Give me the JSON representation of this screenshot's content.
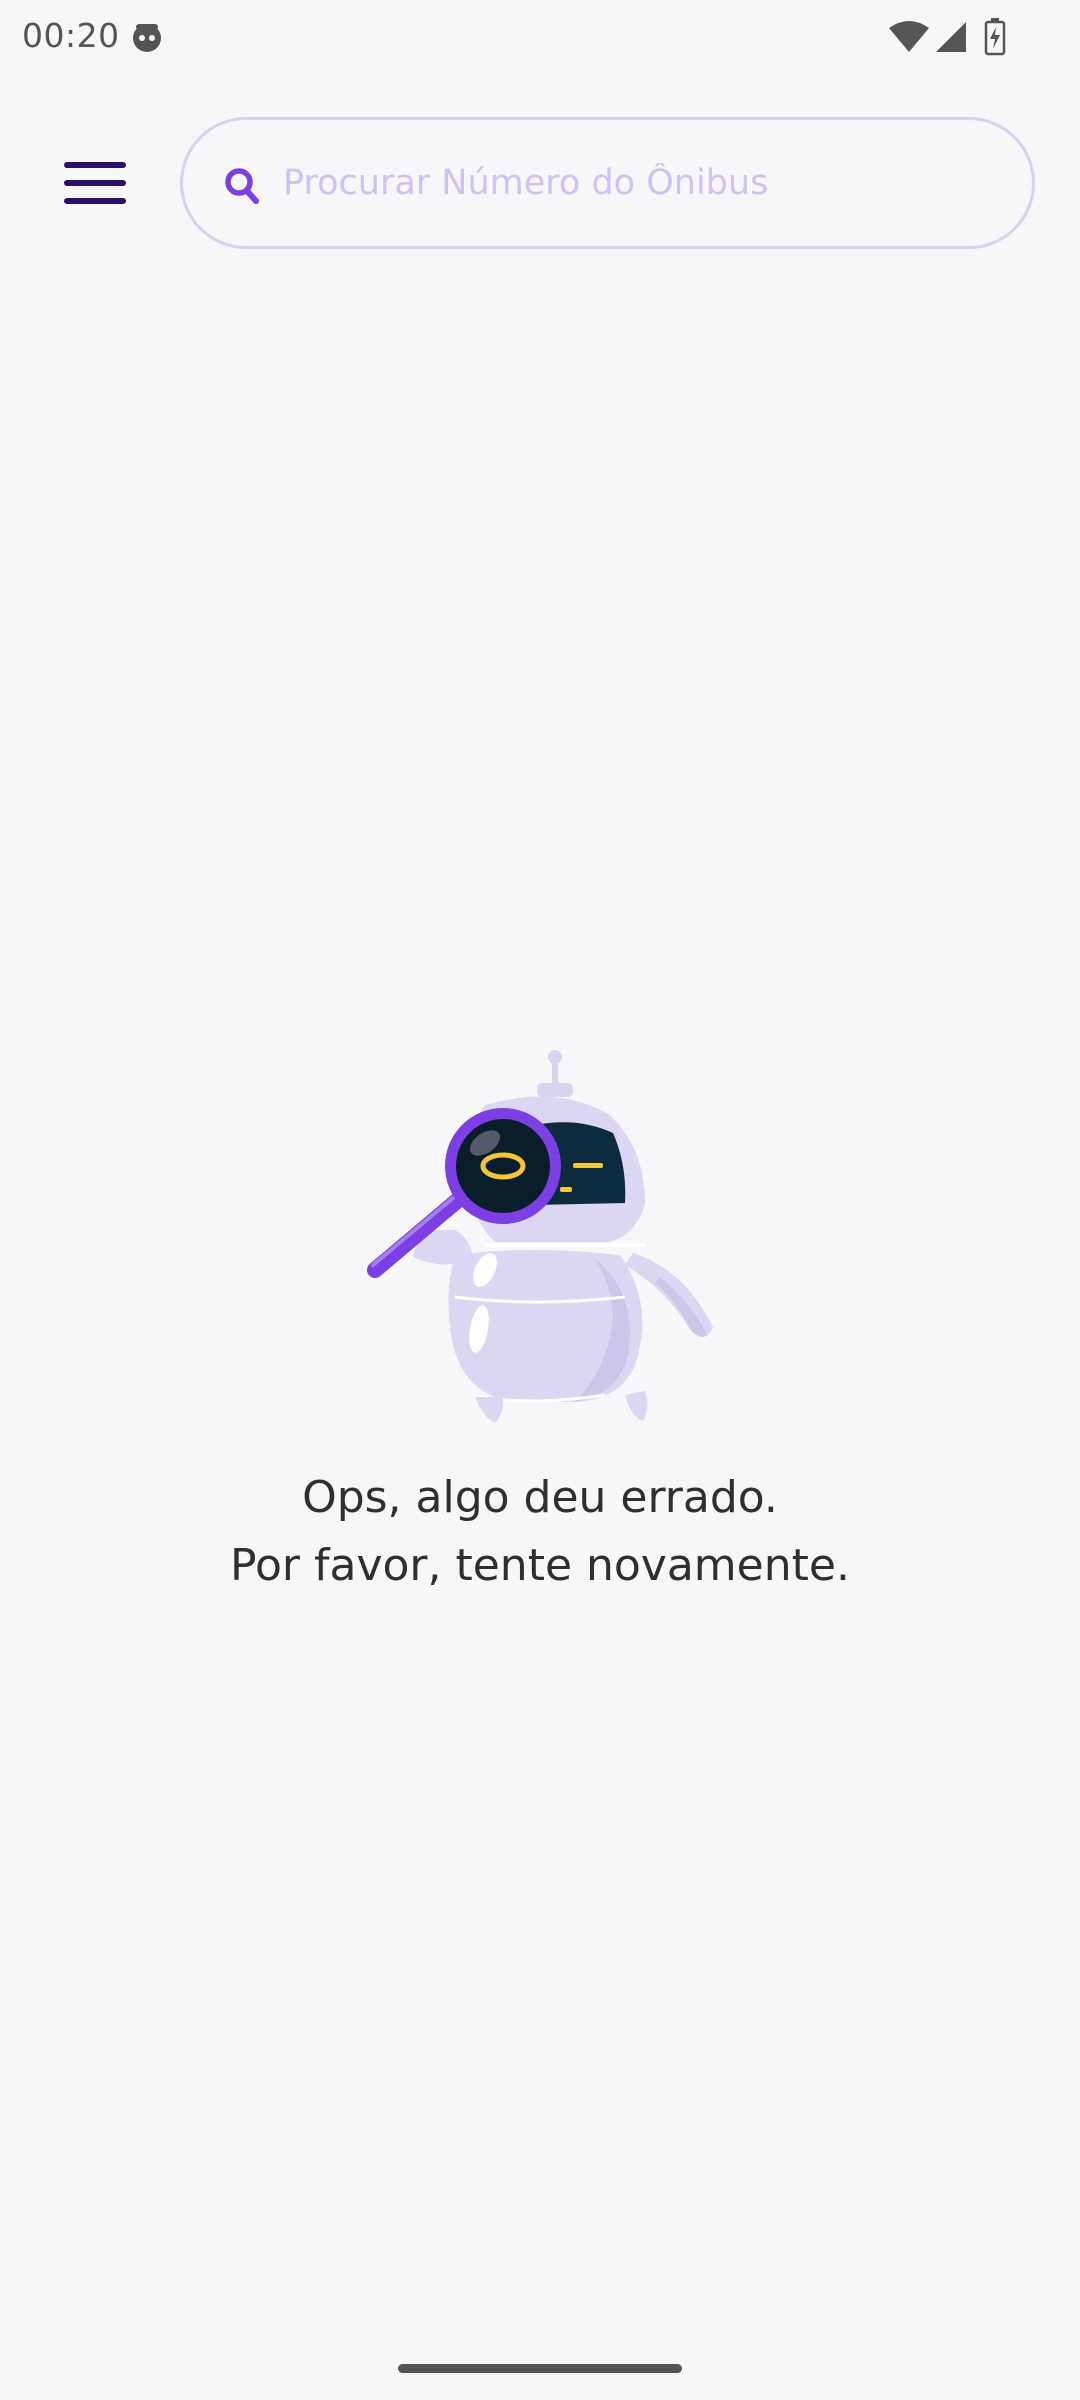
{
  "status_bar": {
    "time": "00:20",
    "notification_icon": "android-face-icon",
    "wifi_icon": "wifi-icon",
    "signal_icon": "cell-signal-icon",
    "battery_icon": "battery-charging-icon"
  },
  "header": {
    "menu_icon": "hamburger-menu-icon",
    "search": {
      "placeholder": "Procurar Número do Ônibus",
      "value": "",
      "icon": "search-icon"
    }
  },
  "empty_state": {
    "illustration": "robot-magnifying-glass-illustration",
    "line1": "Ops, algo deu errado.",
    "line2": "Por favor, tente novamente."
  },
  "colors": {
    "accent": "#7b3fe4",
    "menu_icon": "#2d0d6b",
    "search_border": "#d8d0ef",
    "placeholder": "#cfc2ee",
    "background": "#f7f7f9",
    "text": "#2f2f2f"
  }
}
